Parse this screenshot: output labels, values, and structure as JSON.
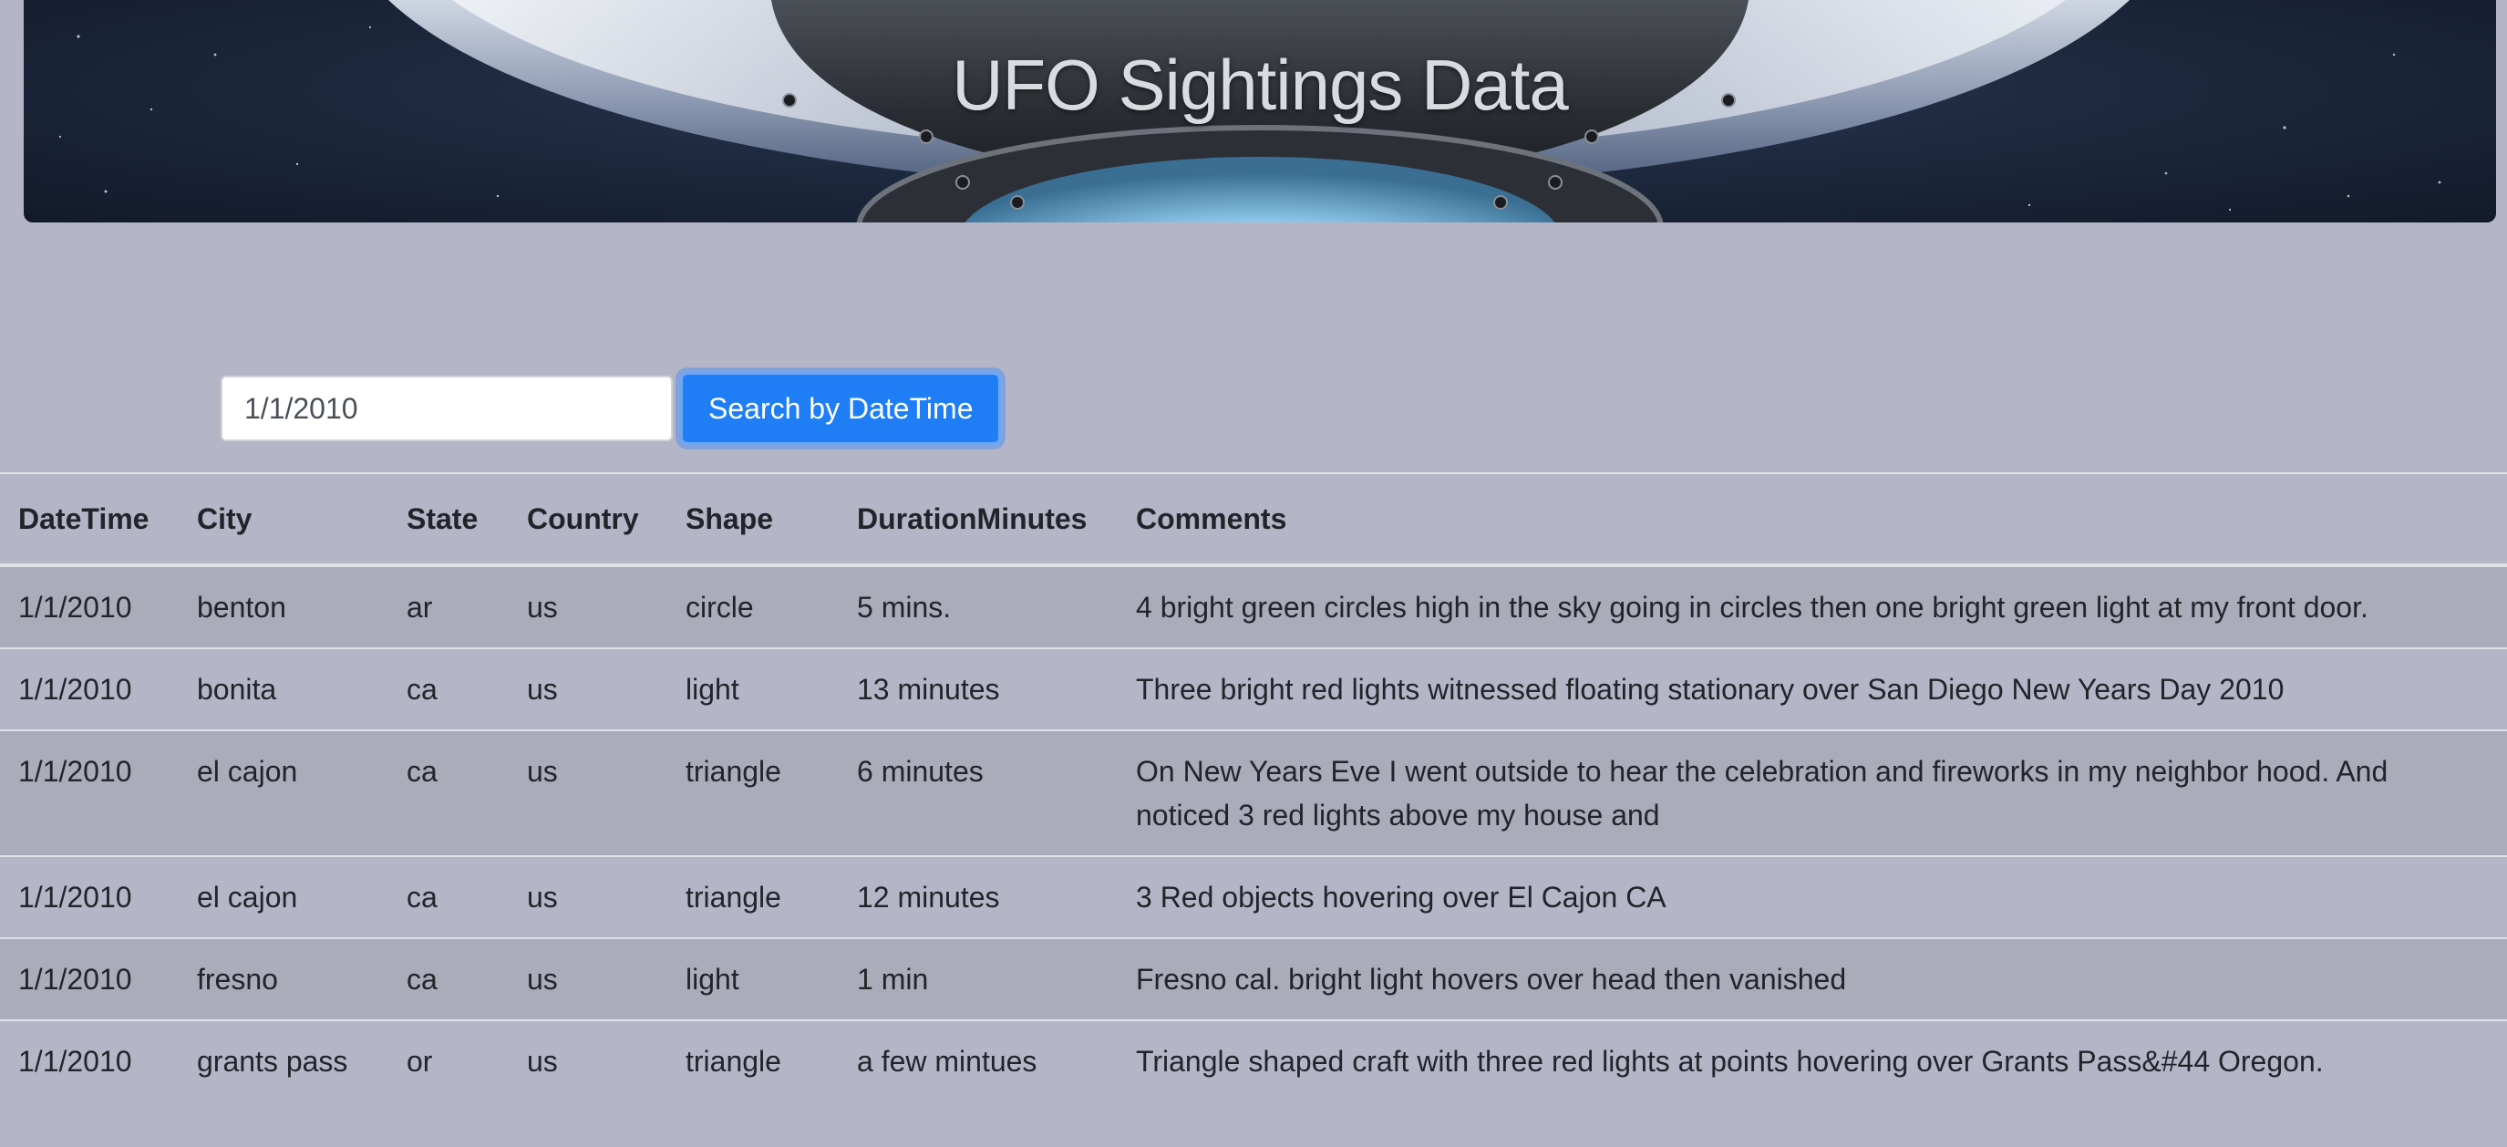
{
  "header": {
    "title": "UFO Sightings Data"
  },
  "search": {
    "value": "1/1/2010",
    "button_label": "Search by DateTime"
  },
  "table": {
    "columns": [
      "DateTime",
      "City",
      "State",
      "Country",
      "Shape",
      "DurationMinutes",
      "Comments"
    ],
    "rows": [
      {
        "datetime": "1/1/2010",
        "city": "benton",
        "state": "ar",
        "country": "us",
        "shape": "circle",
        "duration": "5 mins.",
        "comments": "4 bright green circles high in the sky going in circles then one bright green light at my front door."
      },
      {
        "datetime": "1/1/2010",
        "city": "bonita",
        "state": "ca",
        "country": "us",
        "shape": "light",
        "duration": "13 minutes",
        "comments": "Three bright red lights witnessed floating stationary over San Diego New Years Day 2010"
      },
      {
        "datetime": "1/1/2010",
        "city": "el cajon",
        "state": "ca",
        "country": "us",
        "shape": "triangle",
        "duration": "6 minutes",
        "comments": "On New Years Eve I went outside to hear the celebration and fireworks in my neighbor hood. And noticed 3 red lights above my house and"
      },
      {
        "datetime": "1/1/2010",
        "city": "el cajon",
        "state": "ca",
        "country": "us",
        "shape": "triangle",
        "duration": "12 minutes",
        "comments": "3 Red objects hovering over El Cajon CA"
      },
      {
        "datetime": "1/1/2010",
        "city": "fresno",
        "state": "ca",
        "country": "us",
        "shape": "light",
        "duration": "1 min",
        "comments": "Fresno cal. bright light hovers over head then vanished"
      },
      {
        "datetime": "1/1/2010",
        "city": "grants pass",
        "state": "or",
        "country": "us",
        "shape": "triangle",
        "duration": "a few mintues",
        "comments": "Triangle shaped craft with three red lights at points hovering over Grants Pass&#44 Oregon."
      }
    ]
  }
}
